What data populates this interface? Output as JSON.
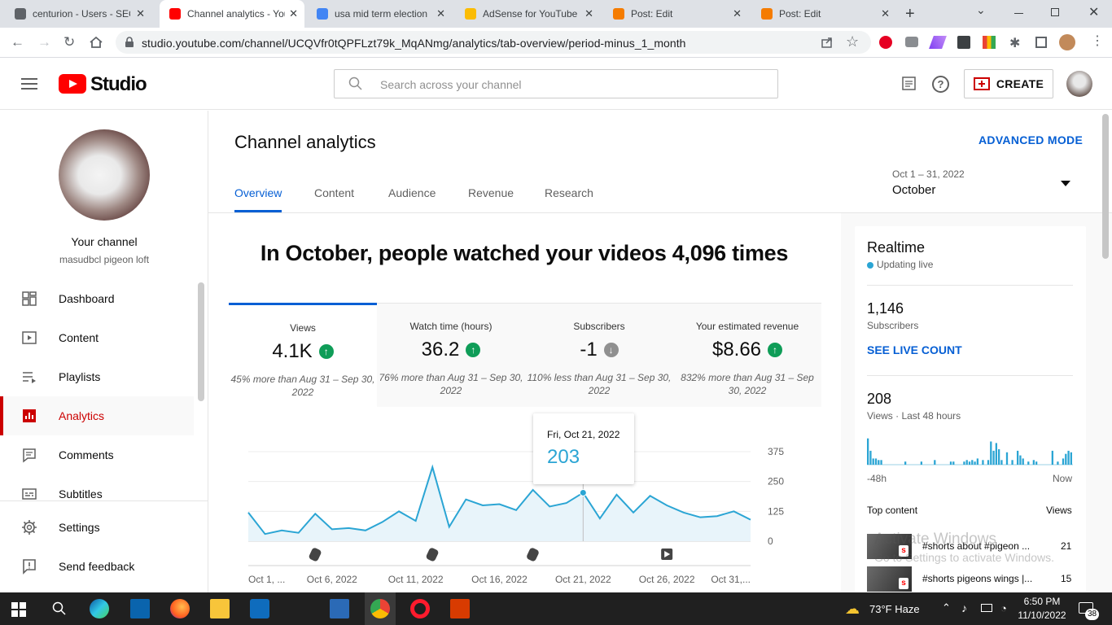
{
  "browser": {
    "tabs": [
      {
        "title": "centurion - Users - SEO",
        "favicon_color": "#5f6368",
        "active": false
      },
      {
        "title": "Channel analytics - YouTube",
        "favicon_color": "#ff0000",
        "active": true
      },
      {
        "title": "usa mid term election",
        "favicon_color": "#4285f4",
        "active": false
      },
      {
        "title": "AdSense for YouTube",
        "favicon_color": "#fbbc04",
        "active": false
      },
      {
        "title": "Post: Edit",
        "favicon_color": "#f57c00",
        "active": false
      },
      {
        "title": "Post: Edit",
        "favicon_color": "#f57c00",
        "active": false
      }
    ],
    "url": "studio.youtube.com/channel/UCQVfr0tQPFLzt79k_MqANmg/analytics/tab-overview/period-minus_1_month"
  },
  "header": {
    "logo_text": "Studio",
    "search_placeholder": "Search across your channel",
    "create_label": "CREATE"
  },
  "sidebar": {
    "channel_title": "Your channel",
    "channel_name": "masudbcl pigeon loft",
    "items": [
      {
        "label": "Dashboard",
        "icon": "dashboard-icon",
        "active": false
      },
      {
        "label": "Content",
        "icon": "content-icon",
        "active": false
      },
      {
        "label": "Playlists",
        "icon": "playlists-icon",
        "active": false
      },
      {
        "label": "Analytics",
        "icon": "analytics-icon",
        "active": true
      },
      {
        "label": "Comments",
        "icon": "comments-icon",
        "active": false
      },
      {
        "label": "Subtitles",
        "icon": "subtitles-icon",
        "active": false
      }
    ],
    "settings_label": "Settings",
    "feedback_label": "Send feedback"
  },
  "main": {
    "title": "Channel analytics",
    "advanced_mode": "ADVANCED MODE",
    "tabs": [
      "Overview",
      "Content",
      "Audience",
      "Revenue",
      "Research"
    ],
    "date_range": "Oct 1 – 31, 2022",
    "date_label": "October",
    "headline": "In October, people watched your videos 4,096 times",
    "metrics": [
      {
        "title": "Views",
        "value": "4.1K",
        "trend": "up",
        "comparison": "45% more than Aug 31 – Sep 30, 2022"
      },
      {
        "title": "Watch time (hours)",
        "value": "36.2",
        "trend": "up",
        "comparison": "76% more than Aug 31 – Sep 30, 2022"
      },
      {
        "title": "Subscribers",
        "value": "-1",
        "trend": "down",
        "comparison": "110% less than Aug 31 – Sep 30, 2022"
      },
      {
        "title": "Your estimated revenue",
        "value": "$8.66",
        "trend": "up",
        "comparison": "832% more than Aug 31 – Sep 30, 2022"
      }
    ],
    "tooltip": {
      "date": "Fri, Oct 21, 2022",
      "value": "203"
    }
  },
  "chart_data": {
    "type": "area",
    "series": [
      {
        "values": [
          120,
          30,
          45,
          35,
          115,
          50,
          55,
          45,
          80,
          125,
          85,
          310,
          60,
          175,
          150,
          155,
          130,
          215,
          145,
          160,
          203,
          95,
          195,
          120,
          190,
          150,
          120,
          100,
          105,
          125,
          90
        ]
      }
    ],
    "x": [
      "Oct 1",
      "Oct 2",
      "Oct 3",
      "Oct 4",
      "Oct 5",
      "Oct 6",
      "Oct 7",
      "Oct 8",
      "Oct 9",
      "Oct 10",
      "Oct 11",
      "Oct 12",
      "Oct 13",
      "Oct 14",
      "Oct 15",
      "Oct 16",
      "Oct 17",
      "Oct 18",
      "Oct 19",
      "Oct 20",
      "Oct 21",
      "Oct 22",
      "Oct 23",
      "Oct 24",
      "Oct 25",
      "Oct 26",
      "Oct 27",
      "Oct 28",
      "Oct 29",
      "Oct 30",
      "Oct 31"
    ],
    "xticks": [
      "Oct 1, ...",
      "Oct 6, 2022",
      "Oct 11, 2022",
      "Oct 16, 2022",
      "Oct 21, 2022",
      "Oct 26, 2022",
      "Oct 31,..."
    ],
    "xtick_days": [
      1,
      6,
      11,
      16,
      21,
      26,
      31
    ],
    "yticks": [
      0,
      125,
      250,
      375
    ],
    "ylim": [
      0,
      375
    ],
    "markers": [
      {
        "day": 5,
        "kind": "shorts"
      },
      {
        "day": 12,
        "kind": "shorts"
      },
      {
        "day": 18,
        "kind": "shorts"
      },
      {
        "day": 26,
        "kind": "video"
      }
    ],
    "color": "#2ba5d4",
    "fill": "#e8f4fa",
    "highlight_day": 21
  },
  "realtime": {
    "title": "Realtime",
    "status": "Updating live",
    "subs_value": "1,146",
    "subs_label": "Subscribers",
    "live_count": "SEE LIVE COUNT",
    "views_value": "208",
    "views_label": "Views · Last 48 hours",
    "bars": [
      0.85,
      0.45,
      0.2,
      0.2,
      0.15,
      0.15,
      0,
      0,
      0,
      0,
      0,
      0,
      0,
      0,
      0.1,
      0,
      0,
      0,
      0,
      0,
      0.1,
      0,
      0,
      0,
      0,
      0.15,
      0,
      0,
      0,
      0,
      0,
      0.1,
      0.1,
      0,
      0,
      0,
      0.1,
      0.15,
      0.1,
      0.15,
      0.1,
      0.2,
      0,
      0.15,
      0,
      0.15,
      0.75,
      0.45,
      0.7,
      0.5,
      0.15,
      0,
      0.4,
      0,
      0.15,
      0,
      0.45,
      0.3,
      0.2,
      0,
      0.1,
      0,
      0.15,
      0.1,
      0,
      0,
      0,
      0,
      0,
      0.45,
      0,
      0.1,
      0,
      0.2,
      0.35,
      0.45,
      0.4
    ],
    "x_start": "-48h",
    "x_end": "Now",
    "top_content_label": "Top content",
    "views_col": "Views",
    "items": [
      {
        "title": "#shorts about #pigeon ...",
        "views": "21"
      },
      {
        "title": "#shorts pigeons wings |...",
        "views": "15"
      }
    ],
    "watermark_title": "Activate Windows",
    "watermark_sub": "Go to Settings to activate Windows."
  },
  "taskbar": {
    "weather": "73°F  Haze",
    "time": "6:50 PM",
    "date": "11/10/2022",
    "notif_count": "38"
  }
}
